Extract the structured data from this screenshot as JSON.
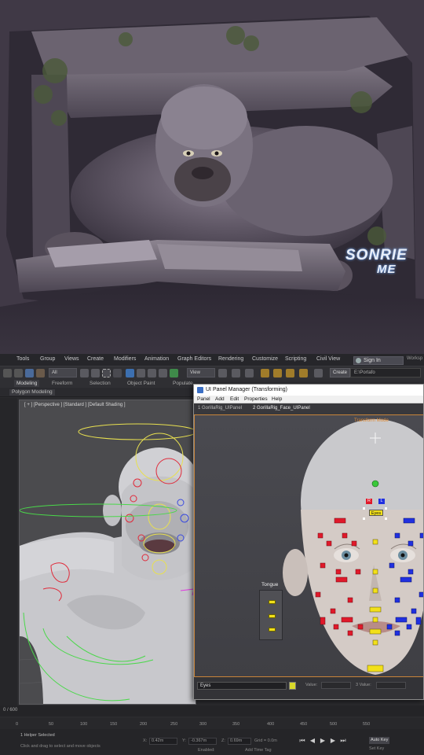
{
  "render": {
    "logo_line1": "SONRIE",
    "logo_line2": "ME"
  },
  "menubar": {
    "items": [
      "Tools",
      "Group",
      "Views",
      "Create",
      "Modifiers",
      "Animation",
      "Graph Editors",
      "Rendering",
      "Customize",
      "Scripting",
      "Civil View"
    ],
    "sign_in": "Sign In",
    "workspaces": "Worksp"
  },
  "toolbar": {
    "filter_select": "All",
    "view_select": "View",
    "create_button": "Create",
    "path": "E:\\Portafo"
  },
  "ribbon": {
    "tabs": [
      "Modeling",
      "Freeform",
      "Selection",
      "Object Paint",
      "Populate"
    ],
    "sub_label": "Polygon Modeling"
  },
  "viewport": {
    "label": "[ + ] [Perspective ] [Standard ] [Default Shading ]"
  },
  "panel_manager": {
    "title": "UI Panel Manager (Transforming)",
    "menu": [
      "Panel",
      "Add",
      "Edit",
      "Properties",
      "Help"
    ],
    "tabs": [
      "1 GorillaRig_UIPanel",
      "2 GorillaRig_Face_UIPanel"
    ],
    "mode_label": "Transform Mode",
    "tongue_label": "Tongue",
    "eyes_label": "Eyes",
    "r_label": "R",
    "l_label": "L",
    "status_input": "Eyes",
    "value_label_1": "Value:",
    "value_label_2": "3 Value:"
  },
  "timeline": {
    "frame_label": "0 / 600",
    "ticks": [
      "0",
      "50",
      "100",
      "150",
      "200",
      "250",
      "300",
      "350",
      "400",
      "450",
      "500",
      "550"
    ]
  },
  "statusbar": {
    "selection": "1 Helper Selected",
    "hint": "Click and drag to select and move objects",
    "x_label": "X:",
    "x_value": "0.42m",
    "y_label": "Y:",
    "y_value": "-0.367m",
    "z_label": "Z:",
    "z_value": "0.69m",
    "grid": "Grid = 0.0m",
    "enabled": "Enabled:",
    "add_time_tag": "Add Time Tag",
    "auto_key": "Auto Key",
    "set_key": "Set Key"
  },
  "colors": {
    "accent_orange": "#e08a33",
    "control_red": "#e0192a",
    "control_blue": "#2030e0",
    "control_yellow": "#f2e01a"
  }
}
